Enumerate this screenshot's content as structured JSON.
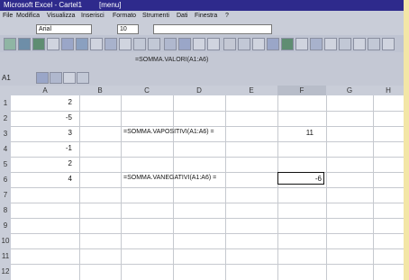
{
  "window": {
    "title": "Microsoft Excel - Cartel1",
    "subtitle": "[menu]"
  },
  "menu": {
    "items": [
      "File",
      "Modifica",
      "Visualizza",
      "Inserisci",
      "Formato",
      "Strumenti",
      "Dati",
      "Finestra",
      "?"
    ]
  },
  "formula_bar": {
    "font_label": "Arial",
    "font_size": "10",
    "name_box": "A1",
    "content": "=SOMMA.VALORI(A1:A6)"
  },
  "sheet": {
    "corner_label": "",
    "columns": [
      "A",
      "B",
      "C",
      "D",
      "E",
      "F",
      "G",
      "H"
    ],
    "rows": [
      "1",
      "2",
      "3",
      "4",
      "5",
      "6",
      "7",
      "8",
      "9",
      "10",
      "11",
      "12"
    ],
    "cells": {
      "A1": "2",
      "A2": "-5",
      "A3": "3",
      "A4": "-1",
      "A5": "2",
      "A6": "4",
      "C2": "=SOMMA.VAPOSITIVI(A1:A6) =",
      "F2": "11",
      "C5": "=SOMMA.VANEGATIVI(A1:A6) =",
      "F5": "-6"
    }
  },
  "colors": {
    "titlebar_bg": "#2e2a8c",
    "toolbar_bg": "#bfc4d2",
    "sheet_bg": "#ffffff",
    "frame_bg": "#f3e6a6"
  }
}
